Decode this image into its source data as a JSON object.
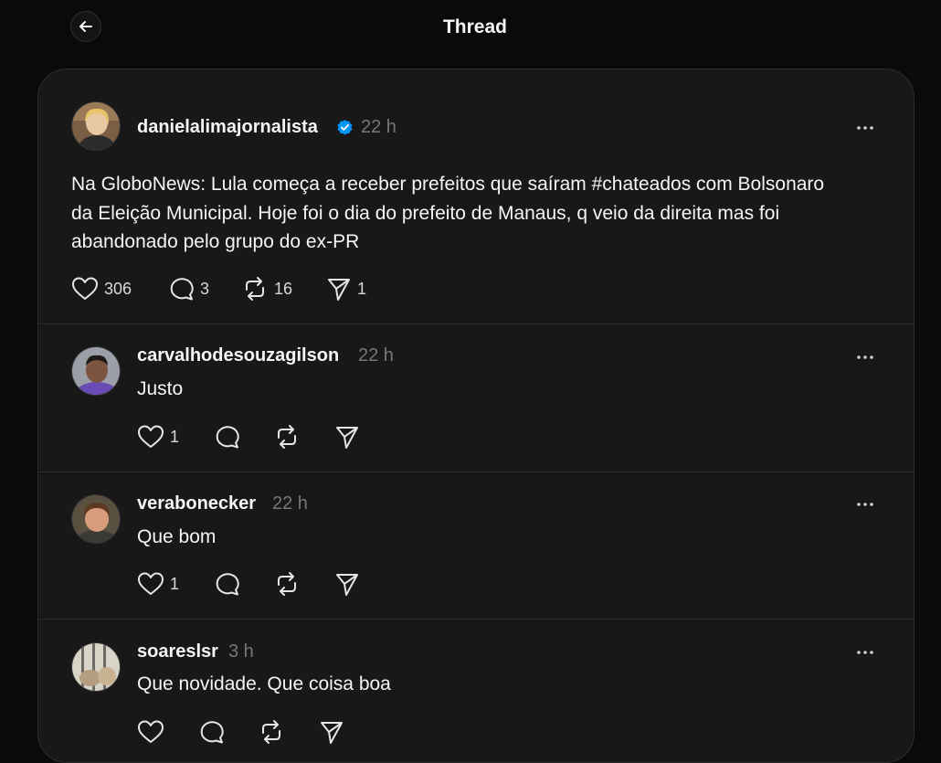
{
  "header": {
    "title": "Thread",
    "back_icon": "arrow-left-icon"
  },
  "colors": {
    "background": "#0a0a0a",
    "card": "#181818",
    "text": "#f3f5f7",
    "muted": "#777777",
    "verified": "#0095f6"
  },
  "main_post": {
    "username": "danielalimajornalista",
    "verified": true,
    "time": "22 h",
    "text": "Na GloboNews: Lula começa a receber prefeitos que saíram #chateados com Bolsonaro\nda Eleição Municipal. Hoje foi o dia do prefeito de Manaus, q veio da direita mas foi\nabandonado pelo grupo do ex-PR",
    "likes": "306",
    "replies": "3",
    "reposts": "16",
    "shares": "1"
  },
  "replies": [
    {
      "username": "carvalhodesouzagilson",
      "time": "22 h",
      "text": "Justo",
      "likes": "1"
    },
    {
      "username": "verabonecker",
      "time": "22 h",
      "text": "Que bom",
      "likes": "1"
    },
    {
      "username": "soareslsr",
      "time": "3 h",
      "text": "Que novidade. Que coisa boa",
      "likes": ""
    }
  ]
}
